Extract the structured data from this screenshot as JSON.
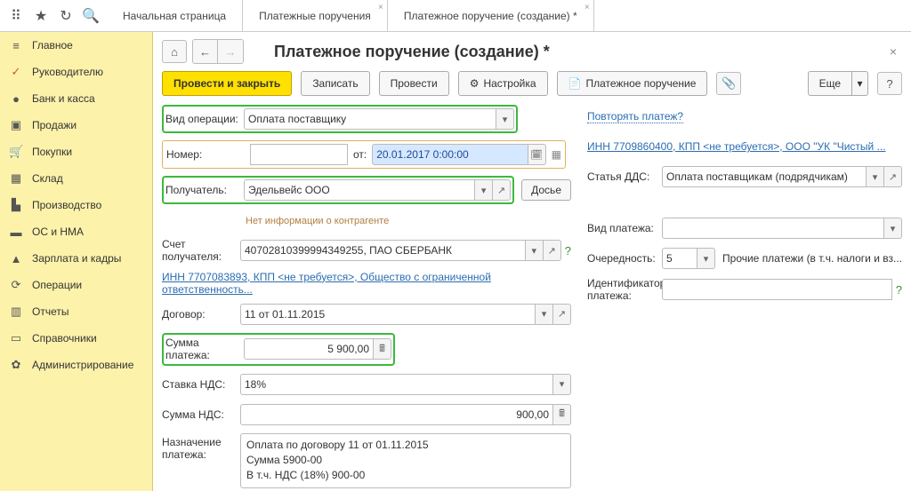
{
  "tabs": {
    "t0": "Начальная страница",
    "t1": "Платежные поручения",
    "t2": "Платежное поручение (создание) *"
  },
  "sidebar": {
    "items": [
      {
        "icon": "≡",
        "label": "Главное"
      },
      {
        "icon": "✓",
        "label": "Руководителю"
      },
      {
        "icon": "●",
        "label": "Банк и касса"
      },
      {
        "icon": "▣",
        "label": "Продажи"
      },
      {
        "icon": "🛒",
        "label": "Покупки"
      },
      {
        "icon": "▦",
        "label": "Склад"
      },
      {
        "icon": "▙",
        "label": "Производство"
      },
      {
        "icon": "▬",
        "label": "ОС и НМА"
      },
      {
        "icon": "▲",
        "label": "Зарплата и кадры"
      },
      {
        "icon": "⟳",
        "label": "Операции"
      },
      {
        "icon": "▥",
        "label": "Отчеты"
      },
      {
        "icon": "▭",
        "label": "Справочники"
      },
      {
        "icon": "✿",
        "label": "Администрирование"
      }
    ]
  },
  "page": {
    "title": "Платежное поручение (создание) *"
  },
  "toolbar": {
    "save_close": "Провести и закрыть",
    "write": "Записать",
    "post": "Провести",
    "settings": "Настройка",
    "po": "Платежное поручение",
    "more": "Еще"
  },
  "labels": {
    "op_type": "Вид операции:",
    "number": "Номер:",
    "from": "от:",
    "recipient": "Получатель:",
    "dossier": "Досье",
    "no_info": "Нет информации о контрагенте",
    "recipient_acct": "Счет получателя:",
    "contract": "Договор:",
    "amount": "Сумма платежа:",
    "vat_rate": "Ставка НДС:",
    "vat_sum": "Сумма НДС:",
    "purpose": "Назначение платежа:",
    "repeat": "Повторять платеж?",
    "dds": "Статья ДДС:",
    "pay_type": "Вид платежа:",
    "priority": "Очередность:",
    "priority_text": "Прочие платежи (в т.ч. налоги и вз...",
    "pay_id": "Идентификатор платежа:"
  },
  "values": {
    "op_type": "Оплата поставщику",
    "number": "",
    "date": "20.01.2017  0:00:00",
    "recipient": "Эдельвейс ООО",
    "recipient_acct": "40702810399994349255, ПАО СБЕРБАНК",
    "inn_link_top": "ИНН 7709860400, КПП <не требуется>, ООО \"УК \"Чистый ...",
    "inn_link_mid": "ИНН 7707083893, КПП <не требуется>, Общество с ограниченной ответственность...",
    "contract": "11 от 01.11.2015",
    "amount": "5 900,00",
    "vat_rate": "18%",
    "vat_sum": "900,00",
    "dds": "Оплата поставщикам (подрядчикам)",
    "priority": "5",
    "purpose_l1": "Оплата по договору 11 от 01.11.2015",
    "purpose_l2": "Сумма 5900-00",
    "purpose_l3": "В т.ч. НДС  (18%) 900-00"
  }
}
